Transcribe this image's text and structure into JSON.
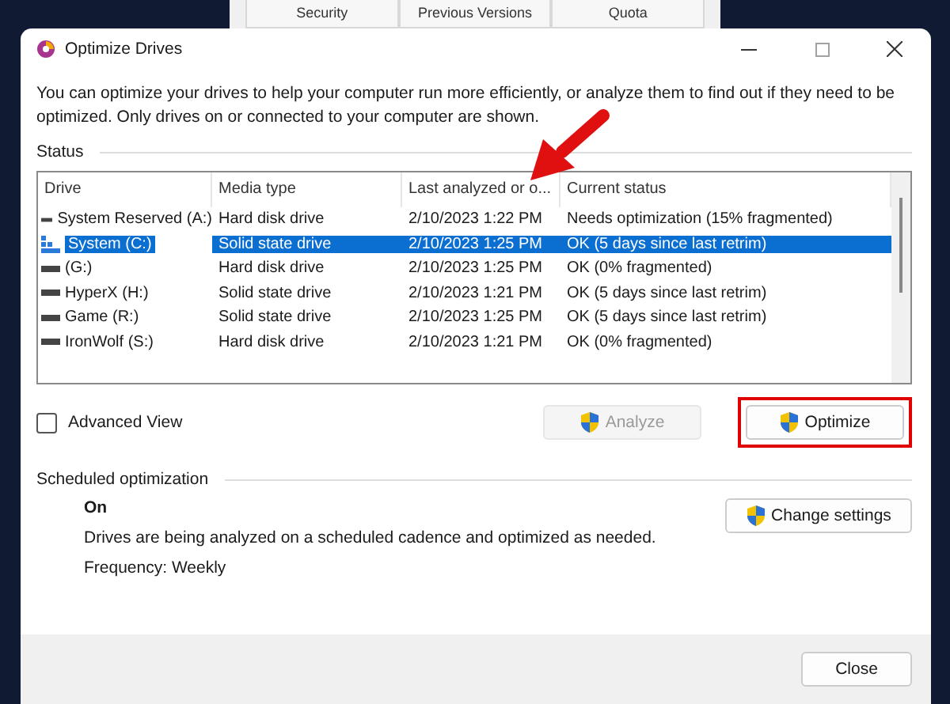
{
  "background_window": {
    "tabs": [
      "Security",
      "Previous Versions",
      "Quota"
    ]
  },
  "window": {
    "title": "Optimize Drives"
  },
  "description": "You can optimize your drives to help your computer run more efficiently, or analyze them to find out if they need to be optimized. Only drives on or connected to your computer are shown.",
  "status": {
    "title": "Status",
    "columns": [
      "Drive",
      "Media type",
      "Last analyzed or o...",
      "Current status"
    ],
    "rows": [
      {
        "kind": "drive",
        "selected": false,
        "cells": [
          "System Reserved (A:)",
          "Hard disk drive",
          "2/10/2023 1:22 PM",
          "Needs optimization (15% fragmented)"
        ]
      },
      {
        "kind": "system",
        "selected": true,
        "cells": [
          "System (C:)",
          "Solid state drive",
          "2/10/2023 1:25 PM",
          "OK (5 days since last retrim)"
        ]
      },
      {
        "kind": "drive",
        "selected": false,
        "cells": [
          "(G:)",
          "Hard disk drive",
          "2/10/2023 1:25 PM",
          "OK (0% fragmented)"
        ]
      },
      {
        "kind": "drive",
        "selected": false,
        "cells": [
          "HyperX (H:)",
          "Solid state drive",
          "2/10/2023 1:21 PM",
          "OK (5 days since last retrim)"
        ]
      },
      {
        "kind": "drive",
        "selected": false,
        "cells": [
          "Game (R:)",
          "Solid state drive",
          "2/10/2023 1:25 PM",
          "OK (5 days since last retrim)"
        ]
      },
      {
        "kind": "drive",
        "selected": false,
        "cells": [
          "IronWolf (S:)",
          "Hard disk drive",
          "2/10/2023 1:21 PM",
          "OK (0% fragmented)"
        ]
      }
    ],
    "advanced_view": {
      "label": "Advanced View",
      "checked": false
    },
    "buttons": [
      {
        "label": "Analyze",
        "disabled": true,
        "highlighted": false
      },
      {
        "label": "Optimize",
        "disabled": false,
        "highlighted": true
      }
    ]
  },
  "scheduled": {
    "title": "Scheduled optimization",
    "state": "On",
    "description": "Drives are being analyzed on a scheduled cadence and optimized as needed.",
    "frequency": "Frequency: Weekly",
    "button": "Change settings"
  },
  "footer": {
    "button": "Close"
  }
}
